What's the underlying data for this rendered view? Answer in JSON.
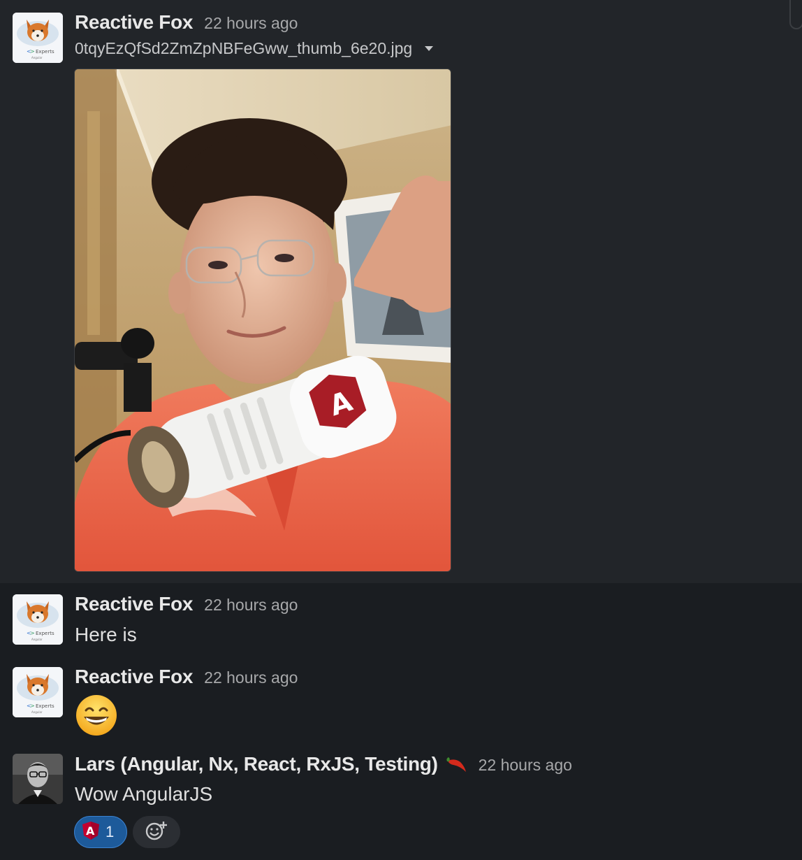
{
  "messages": [
    {
      "author": "Reactive Fox",
      "time": "22 hours ago",
      "file": {
        "name": "0tqyEzQfSd2ZmZpNBFeGww_thumb_6e20.jpg"
      },
      "avatar_text": "Experts",
      "avatar_sub": "Angular"
    },
    {
      "author": "Reactive Fox",
      "time": "22 hours ago",
      "text": "Here is",
      "avatar_text": "Experts",
      "avatar_sub": "Angular"
    },
    {
      "author": "Reactive Fox",
      "time": "22 hours ago",
      "emoji": "grinning-face-emoji",
      "avatar_text": "Experts",
      "avatar_sub": "Angular"
    },
    {
      "author": "Lars (Angular, Nx, React, RxJS, Testing)",
      "time": "22 hours ago",
      "status_emoji": "red-chili-icon",
      "text": "Wow AngularJS",
      "reactions": [
        {
          "emoji": "angularjs-icon",
          "count": "1"
        }
      ]
    }
  ],
  "colors": {
    "background": "#1a1d21",
    "highlight": "#222529",
    "reaction_bg": "#1d5a9a",
    "reaction_border": "#3b82d0",
    "angular_red": "#c3002f"
  }
}
